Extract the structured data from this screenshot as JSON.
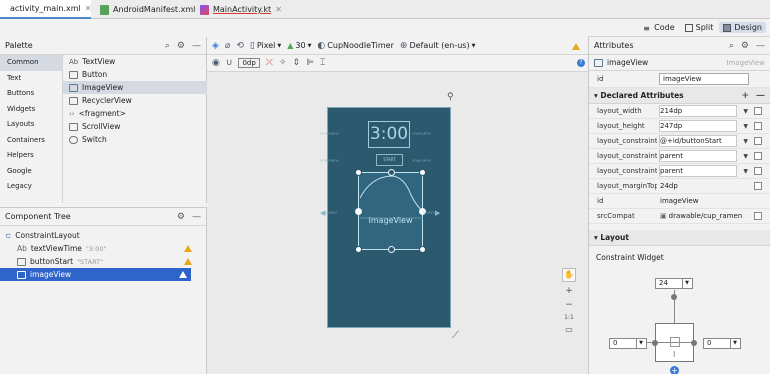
{
  "tabs": [
    {
      "label": "activity_main.xml",
      "icon": "xml-layout-icon",
      "active": true
    },
    {
      "label": "AndroidManifest.xml",
      "icon": "manifest-icon",
      "active": false
    },
    {
      "label": "MainActivity.kt",
      "icon": "kotlin-file-icon",
      "active": false
    }
  ],
  "view_modes": {
    "code": "Code",
    "split": "Split",
    "design": "Design",
    "active": "Design"
  },
  "palette": {
    "title": "Palette",
    "categories": [
      "Common",
      "Text",
      "Buttons",
      "Widgets",
      "Layouts",
      "Containers",
      "Helpers",
      "Google",
      "Legacy"
    ],
    "active_category": "Common",
    "widgets": [
      {
        "icon": "text-view-icon",
        "label": "TextView"
      },
      {
        "icon": "button-icon",
        "label": "Button"
      },
      {
        "icon": "image-view-icon",
        "label": "ImageView",
        "selected": true
      },
      {
        "icon": "recycler-view-icon",
        "label": "RecyclerView"
      },
      {
        "icon": "fragment-icon",
        "label": "<fragment>"
      },
      {
        "icon": "scroll-view-icon",
        "label": "ScrollView"
      },
      {
        "icon": "switch-icon",
        "label": "Switch"
      }
    ]
  },
  "component_tree": {
    "title": "Component Tree",
    "nodes": [
      {
        "label": "ConstraintLayout",
        "hint": "",
        "depth": 0,
        "warning": false
      },
      {
        "label": "textViewTime",
        "hint": "\"3:00\"",
        "depth": 1,
        "warning": true
      },
      {
        "label": "buttonStart",
        "hint": "\"START\"",
        "depth": 1,
        "warning": true
      },
      {
        "label": "imageView",
        "hint": "",
        "depth": 1,
        "warning": true,
        "selected": true
      }
    ]
  },
  "design_toolbar": {
    "device": "Pixel",
    "api": "30",
    "theme": "CupNoodleTimer",
    "locale": "Default (en-us)",
    "default_margin": "0dp"
  },
  "canvas": {
    "clock_text": "3:00",
    "start_text": "START",
    "image_label": "ImageView",
    "zoom_ratio": "1:1"
  },
  "attributes": {
    "title": "Attributes",
    "component": "imageView",
    "component_type": "ImageView",
    "id_label": "id",
    "id_value": "imageView",
    "declared_title": "Declared Attributes",
    "declared": [
      {
        "name": "layout_width",
        "value": "214dp",
        "dropdown": true
      },
      {
        "name": "layout_height",
        "value": "247dp",
        "dropdown": true
      },
      {
        "name": "layout_constraint...",
        "value": "@+id/buttonStart",
        "dropdown": true
      },
      {
        "name": "layout_constraint...",
        "value": "parent",
        "dropdown": true
      },
      {
        "name": "layout_constraint...",
        "value": "parent",
        "dropdown": true
      },
      {
        "name": "layout_marginTop",
        "value": "24dp",
        "dropdown": false
      },
      {
        "name": "id",
        "value": "imageView",
        "dropdown": false
      },
      {
        "name": "srcCompat",
        "value": "drawable/cup_ramen",
        "dropdown": false
      }
    ],
    "layout_title": "Layout",
    "constraint_widget_title": "Constraint Widget",
    "margin_top": "24",
    "margin_left": "0",
    "margin_right": "0"
  },
  "colors": {
    "device_bg": "#2b5a6f",
    "selection": "#2f65ca",
    "warning": "#e6a817",
    "accent": "#3b7bd4"
  }
}
